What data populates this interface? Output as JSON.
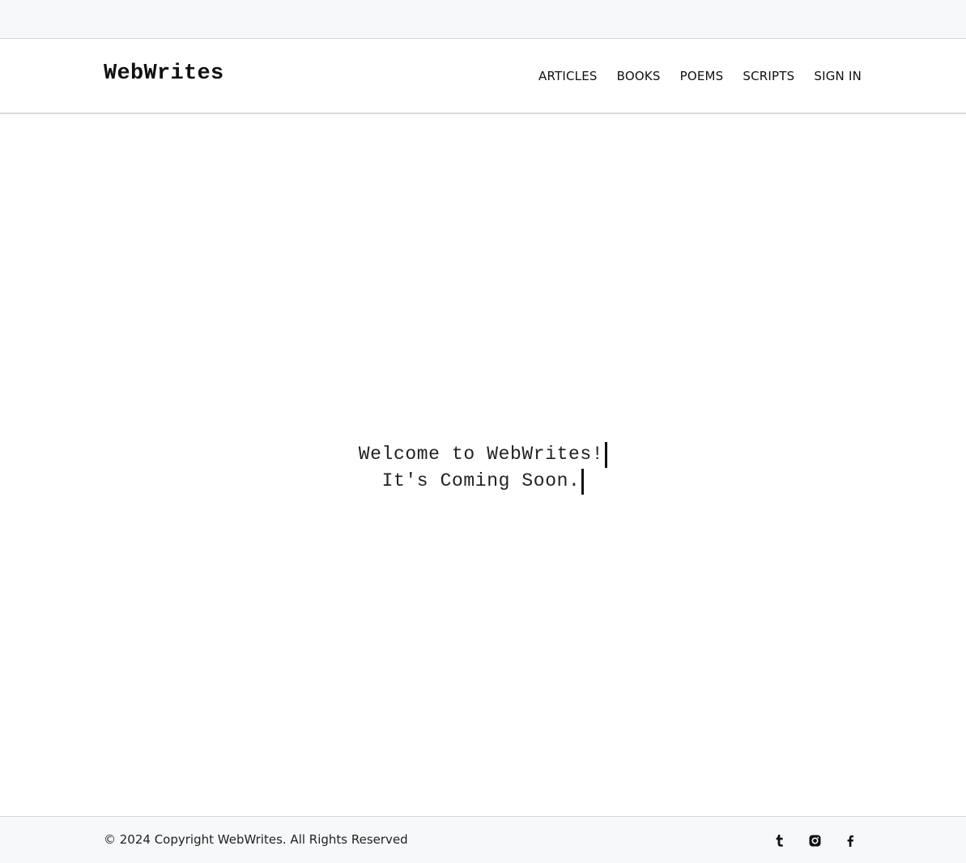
{
  "header": {
    "brand": "WebWrites",
    "nav": [
      "ARTICLES",
      "BOOKS",
      "POEMS",
      "SCRIPTS",
      "SIGN IN"
    ]
  },
  "hero": {
    "line1": "Welcome to WebWrites!",
    "line2": "It's Coming Soon."
  },
  "footer": {
    "copyright": "© 2024 Copyright WebWrites. All Rights Reserved",
    "social_icons": [
      "tumblr-icon",
      "instagram-icon",
      "facebook-icon"
    ]
  },
  "colors": {
    "bar_background": "#f7f8fa",
    "text": "#111111",
    "divider": "#d6d6d6"
  }
}
